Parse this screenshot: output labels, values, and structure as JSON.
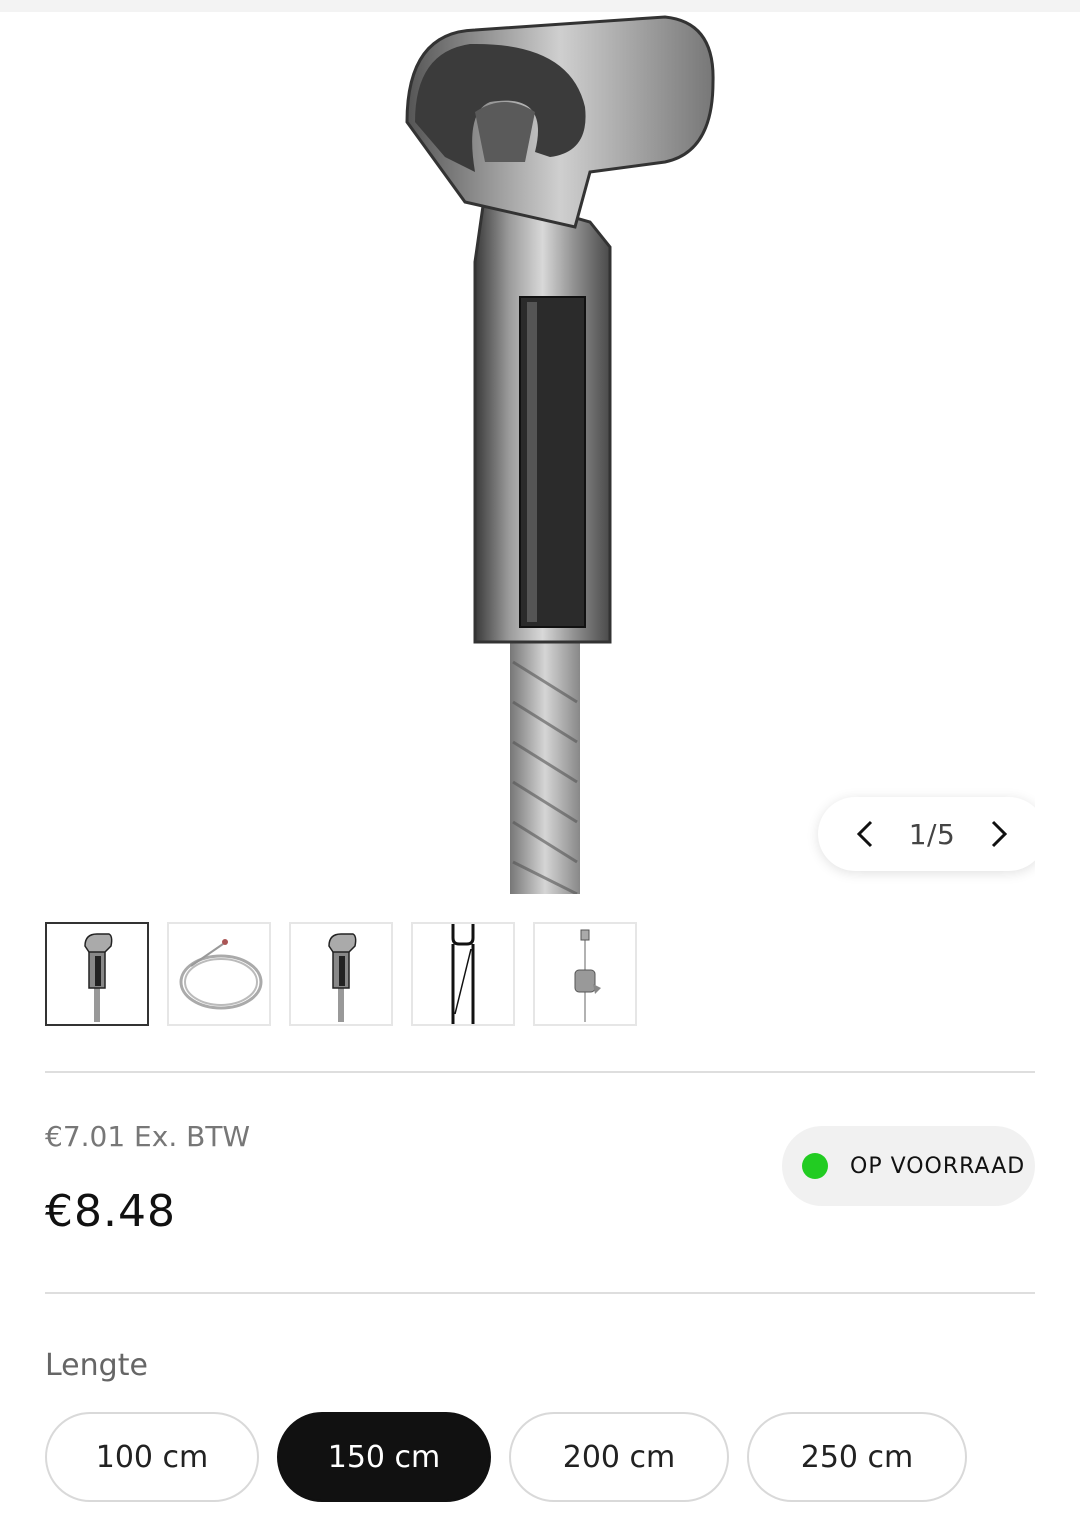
{
  "gallery": {
    "image_alt": "",
    "counter": "1/5",
    "prev_icon": "chevron-left-icon",
    "next_icon": "chevron-right-icon",
    "thumbnails": [
      {
        "name": "thumb-cable-gripper",
        "active": true
      },
      {
        "name": "thumb-cable-coil",
        "active": false
      },
      {
        "name": "thumb-cable-gripper-alt",
        "active": false
      },
      {
        "name": "thumb-cable-drawing",
        "active": false
      },
      {
        "name": "thumb-cable-hook",
        "active": false
      }
    ]
  },
  "pricing": {
    "ex_vat": "€7.01 Ex. BTW",
    "price": "€8.48"
  },
  "stock": {
    "label": "OP VOORRAAD",
    "color": "#22cc22"
  },
  "options": {
    "title": "Lengte",
    "values": [
      "100 cm",
      "150 cm",
      "200 cm",
      "250 cm"
    ],
    "selected": "150 cm"
  }
}
